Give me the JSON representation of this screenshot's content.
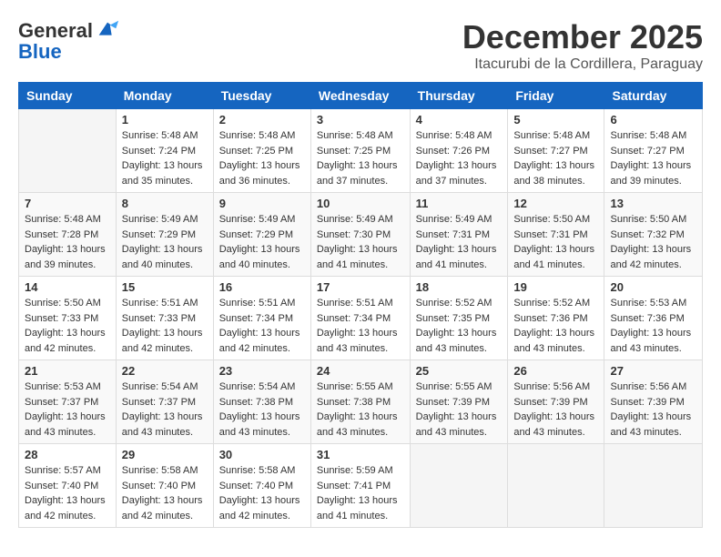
{
  "header": {
    "logo_line1": "General",
    "logo_line2": "Blue",
    "month": "December 2025",
    "location": "Itacurubi de la Cordillera, Paraguay"
  },
  "weekdays": [
    "Sunday",
    "Monday",
    "Tuesday",
    "Wednesday",
    "Thursday",
    "Friday",
    "Saturday"
  ],
  "weeks": [
    [
      {
        "day": "",
        "sunrise": "",
        "sunset": "",
        "daylight": ""
      },
      {
        "day": "1",
        "sunrise": "Sunrise: 5:48 AM",
        "sunset": "Sunset: 7:24 PM",
        "daylight": "Daylight: 13 hours and 35 minutes."
      },
      {
        "day": "2",
        "sunrise": "Sunrise: 5:48 AM",
        "sunset": "Sunset: 7:25 PM",
        "daylight": "Daylight: 13 hours and 36 minutes."
      },
      {
        "day": "3",
        "sunrise": "Sunrise: 5:48 AM",
        "sunset": "Sunset: 7:25 PM",
        "daylight": "Daylight: 13 hours and 37 minutes."
      },
      {
        "day": "4",
        "sunrise": "Sunrise: 5:48 AM",
        "sunset": "Sunset: 7:26 PM",
        "daylight": "Daylight: 13 hours and 37 minutes."
      },
      {
        "day": "5",
        "sunrise": "Sunrise: 5:48 AM",
        "sunset": "Sunset: 7:27 PM",
        "daylight": "Daylight: 13 hours and 38 minutes."
      },
      {
        "day": "6",
        "sunrise": "Sunrise: 5:48 AM",
        "sunset": "Sunset: 7:27 PM",
        "daylight": "Daylight: 13 hours and 39 minutes."
      }
    ],
    [
      {
        "day": "7",
        "sunrise": "Sunrise: 5:48 AM",
        "sunset": "Sunset: 7:28 PM",
        "daylight": "Daylight: 13 hours and 39 minutes."
      },
      {
        "day": "8",
        "sunrise": "Sunrise: 5:49 AM",
        "sunset": "Sunset: 7:29 PM",
        "daylight": "Daylight: 13 hours and 40 minutes."
      },
      {
        "day": "9",
        "sunrise": "Sunrise: 5:49 AM",
        "sunset": "Sunset: 7:29 PM",
        "daylight": "Daylight: 13 hours and 40 minutes."
      },
      {
        "day": "10",
        "sunrise": "Sunrise: 5:49 AM",
        "sunset": "Sunset: 7:30 PM",
        "daylight": "Daylight: 13 hours and 41 minutes."
      },
      {
        "day": "11",
        "sunrise": "Sunrise: 5:49 AM",
        "sunset": "Sunset: 7:31 PM",
        "daylight": "Daylight: 13 hours and 41 minutes."
      },
      {
        "day": "12",
        "sunrise": "Sunrise: 5:50 AM",
        "sunset": "Sunset: 7:31 PM",
        "daylight": "Daylight: 13 hours and 41 minutes."
      },
      {
        "day": "13",
        "sunrise": "Sunrise: 5:50 AM",
        "sunset": "Sunset: 7:32 PM",
        "daylight": "Daylight: 13 hours and 42 minutes."
      }
    ],
    [
      {
        "day": "14",
        "sunrise": "Sunrise: 5:50 AM",
        "sunset": "Sunset: 7:33 PM",
        "daylight": "Daylight: 13 hours and 42 minutes."
      },
      {
        "day": "15",
        "sunrise": "Sunrise: 5:51 AM",
        "sunset": "Sunset: 7:33 PM",
        "daylight": "Daylight: 13 hours and 42 minutes."
      },
      {
        "day": "16",
        "sunrise": "Sunrise: 5:51 AM",
        "sunset": "Sunset: 7:34 PM",
        "daylight": "Daylight: 13 hours and 42 minutes."
      },
      {
        "day": "17",
        "sunrise": "Sunrise: 5:51 AM",
        "sunset": "Sunset: 7:34 PM",
        "daylight": "Daylight: 13 hours and 43 minutes."
      },
      {
        "day": "18",
        "sunrise": "Sunrise: 5:52 AM",
        "sunset": "Sunset: 7:35 PM",
        "daylight": "Daylight: 13 hours and 43 minutes."
      },
      {
        "day": "19",
        "sunrise": "Sunrise: 5:52 AM",
        "sunset": "Sunset: 7:36 PM",
        "daylight": "Daylight: 13 hours and 43 minutes."
      },
      {
        "day": "20",
        "sunrise": "Sunrise: 5:53 AM",
        "sunset": "Sunset: 7:36 PM",
        "daylight": "Daylight: 13 hours and 43 minutes."
      }
    ],
    [
      {
        "day": "21",
        "sunrise": "Sunrise: 5:53 AM",
        "sunset": "Sunset: 7:37 PM",
        "daylight": "Daylight: 13 hours and 43 minutes."
      },
      {
        "day": "22",
        "sunrise": "Sunrise: 5:54 AM",
        "sunset": "Sunset: 7:37 PM",
        "daylight": "Daylight: 13 hours and 43 minutes."
      },
      {
        "day": "23",
        "sunrise": "Sunrise: 5:54 AM",
        "sunset": "Sunset: 7:38 PM",
        "daylight": "Daylight: 13 hours and 43 minutes."
      },
      {
        "day": "24",
        "sunrise": "Sunrise: 5:55 AM",
        "sunset": "Sunset: 7:38 PM",
        "daylight": "Daylight: 13 hours and 43 minutes."
      },
      {
        "day": "25",
        "sunrise": "Sunrise: 5:55 AM",
        "sunset": "Sunset: 7:39 PM",
        "daylight": "Daylight: 13 hours and 43 minutes."
      },
      {
        "day": "26",
        "sunrise": "Sunrise: 5:56 AM",
        "sunset": "Sunset: 7:39 PM",
        "daylight": "Daylight: 13 hours and 43 minutes."
      },
      {
        "day": "27",
        "sunrise": "Sunrise: 5:56 AM",
        "sunset": "Sunset: 7:39 PM",
        "daylight": "Daylight: 13 hours and 43 minutes."
      }
    ],
    [
      {
        "day": "28",
        "sunrise": "Sunrise: 5:57 AM",
        "sunset": "Sunset: 7:40 PM",
        "daylight": "Daylight: 13 hours and 42 minutes."
      },
      {
        "day": "29",
        "sunrise": "Sunrise: 5:58 AM",
        "sunset": "Sunset: 7:40 PM",
        "daylight": "Daylight: 13 hours and 42 minutes."
      },
      {
        "day": "30",
        "sunrise": "Sunrise: 5:58 AM",
        "sunset": "Sunset: 7:40 PM",
        "daylight": "Daylight: 13 hours and 42 minutes."
      },
      {
        "day": "31",
        "sunrise": "Sunrise: 5:59 AM",
        "sunset": "Sunset: 7:41 PM",
        "daylight": "Daylight: 13 hours and 41 minutes."
      },
      {
        "day": "",
        "sunrise": "",
        "sunset": "",
        "daylight": ""
      },
      {
        "day": "",
        "sunrise": "",
        "sunset": "",
        "daylight": ""
      },
      {
        "day": "",
        "sunrise": "",
        "sunset": "",
        "daylight": ""
      }
    ]
  ]
}
